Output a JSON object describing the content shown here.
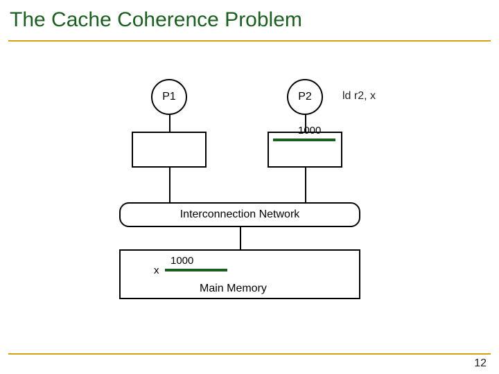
{
  "slide": {
    "title": "The Cache Coherence Problem",
    "page_number": "12"
  },
  "processors": {
    "p1": {
      "label": "P1"
    },
    "p2": {
      "label": "P2",
      "annotation": "ld r2, x",
      "cache_value": "1000"
    }
  },
  "interconnect": {
    "label": "Interconnection Network"
  },
  "memory": {
    "label": "Main Memory",
    "var": "x",
    "value": "1000"
  }
}
